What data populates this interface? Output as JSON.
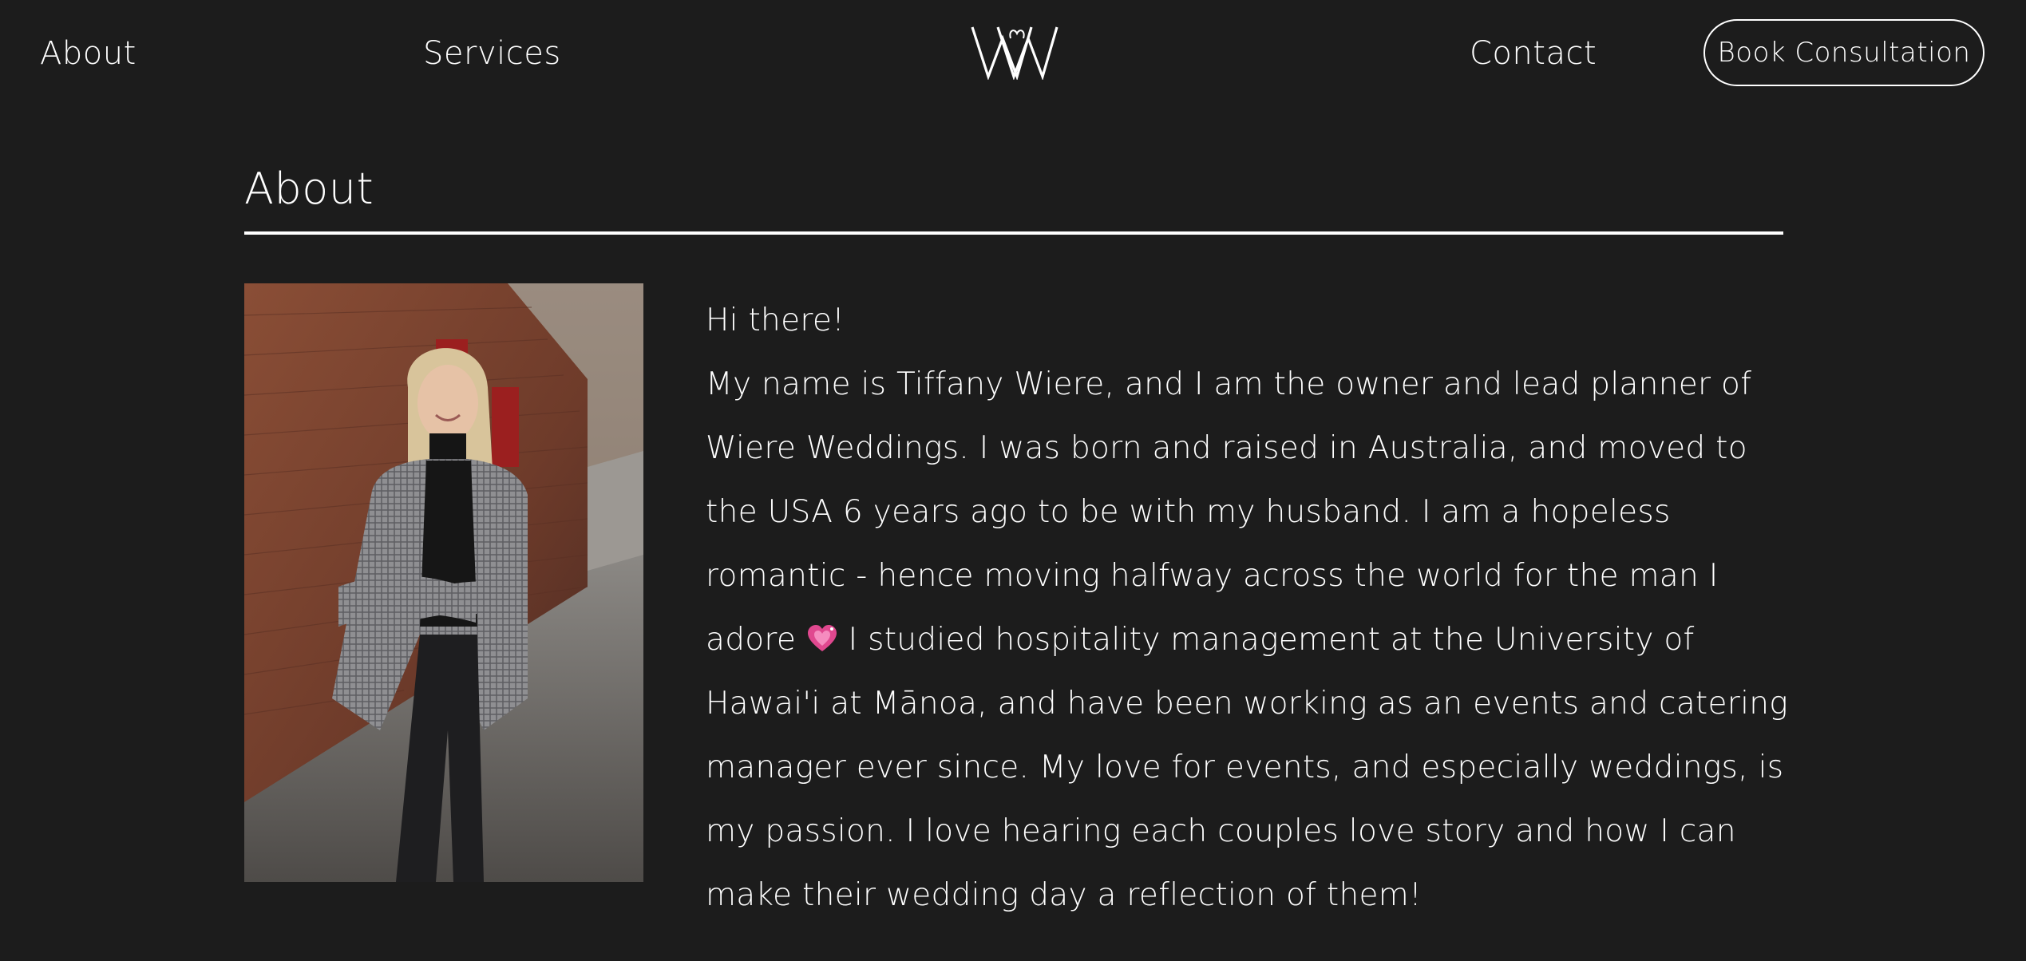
{
  "header": {
    "nav": {
      "about": "About",
      "services": "Services",
      "contact": "Contact"
    },
    "logo_icon": "W-monogram-logo",
    "book_button": "Book Consultation"
  },
  "about_section": {
    "title": "About",
    "photo_icon": "portrait-photo",
    "greeting": "Hi there!",
    "bio_part1": "My name is Tiffany Wiere, and I am the owner and lead planner of Wiere Weddings. I was born and raised in Australia, and moved to the USA 6 years ago to be with my husband. I am a hopeless romantic - hence moving halfway across the world for the man I adore",
    "heart_icon": "sparkling-heart-emoji",
    "bio_part2": "I studied hospitality management at the University of Hawai'i at Mānoa, and have been working as an events and catering manager ever since. My love for events, and especially weddings, is my passion. I love hearing each couples love story and how I can make their wedding day a reflection of them!"
  },
  "colors": {
    "background": "#1c1c1c",
    "text": "#ffffff",
    "heart": "#e0488f"
  }
}
